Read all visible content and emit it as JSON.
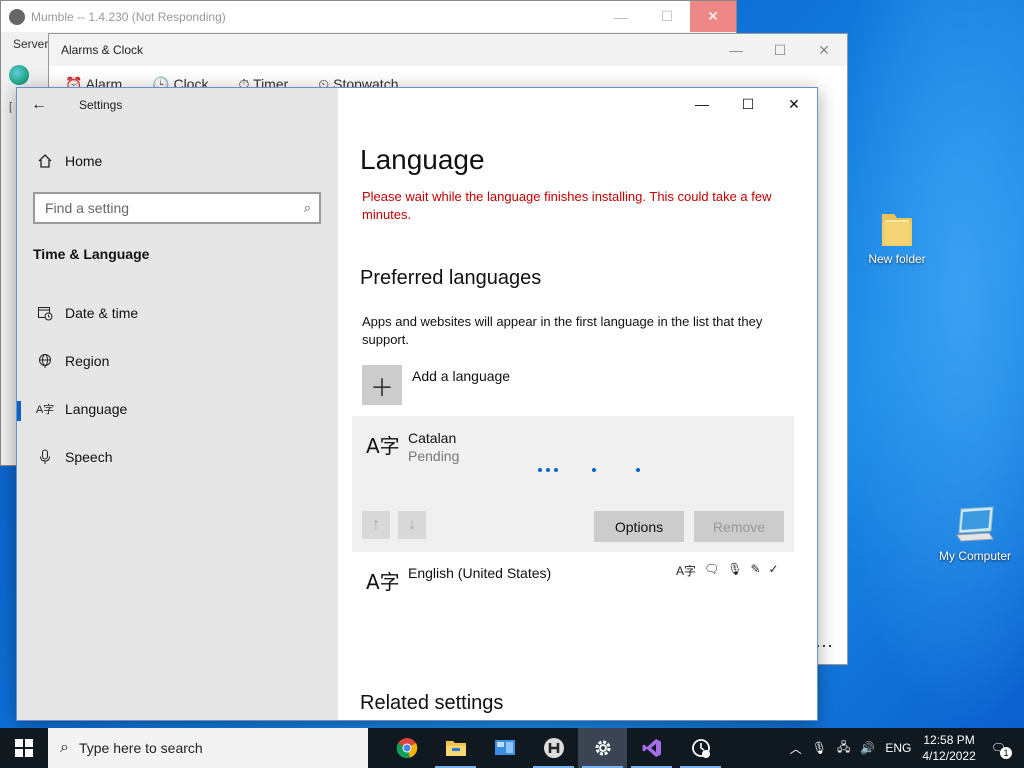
{
  "desktop": {
    "icons": [
      {
        "label": "New folder",
        "icon": "folder-icon"
      },
      {
        "label": "My Computer",
        "icon": "computer-icon"
      }
    ]
  },
  "mumble": {
    "title": "Mumble -- 1.4.230 (Not Responding)",
    "menu_partial": "Server",
    "side_marker": "[",
    "controls": {
      "minimize": "—",
      "maximize": "☐",
      "close": "✕"
    }
  },
  "alarms": {
    "title": "Alarms & Clock",
    "tabs": [
      "Alarm",
      "Clock",
      "Timer",
      "Stopwatch"
    ],
    "more": "···",
    "controls": {
      "minimize": "—",
      "maximize": "☐",
      "close": "✕"
    }
  },
  "settings": {
    "app_title": "Settings",
    "back": "←",
    "controls": {
      "minimize": "—",
      "maximize": "☐",
      "close": "✕"
    },
    "nav": {
      "home": "Home",
      "search_placeholder": "Find a setting",
      "section": "Time & Language",
      "items": [
        {
          "label": "Date & time",
          "icon": "calendar-clock-icon",
          "glyph": "🗓"
        },
        {
          "label": "Region",
          "icon": "globe-icon",
          "glyph": "◎"
        },
        {
          "label": "Language",
          "icon": "language-icon",
          "glyph": "A字"
        },
        {
          "label": "Speech",
          "icon": "microphone-icon",
          "glyph": "🎙"
        }
      ],
      "active": "Language"
    },
    "main": {
      "title": "Language",
      "warning": "Please wait while the language finishes installing. This could take a few minutes.",
      "preferred_heading": "Preferred languages",
      "preferred_desc": "Apps and websites will appear in the first language in the list that they support.",
      "add_language": "Add a language",
      "languages": [
        {
          "name": "Catalan",
          "status": "Pending",
          "glyph": "A字"
        },
        {
          "name": "English (United States)",
          "status": "",
          "glyph": "A字"
        }
      ],
      "buttons": {
        "options": "Options",
        "remove": "Remove",
        "up": "↑",
        "down": "↓"
      },
      "feature_icons": [
        "display-language-icon",
        "text-to-speech-icon",
        "speech-icon",
        "handwriting-icon",
        "spellcheck-icon"
      ],
      "related_heading": "Related settings"
    }
  },
  "taskbar": {
    "search_placeholder": "Type here to search",
    "apps": [
      "chrome-icon",
      "file-explorer-icon",
      "control-panel-icon",
      "mumble-icon",
      "settings-icon",
      "visual-studio-icon",
      "alarms-clock-icon"
    ],
    "active_app": "settings-icon",
    "language": "ENG",
    "time": "12:58 PM",
    "date": "4/12/2022",
    "notification_count": "1"
  },
  "colors": {
    "accent": "#0a64c8",
    "warning": "#c00000",
    "desktop": "#0d6fd6"
  }
}
